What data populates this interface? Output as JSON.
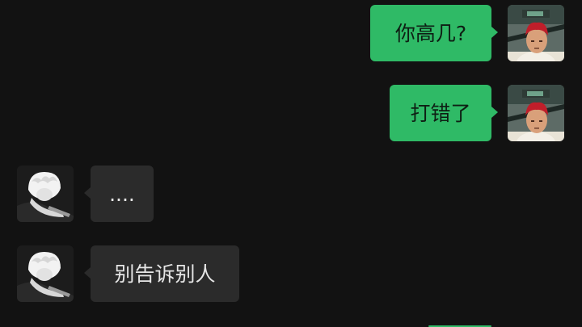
{
  "conversation": {
    "messages": [
      {
        "side": "right",
        "avatar": "sender-avatar-icon",
        "text": "你高几?"
      },
      {
        "side": "right",
        "avatar": "sender-avatar-icon",
        "text": "打错了"
      },
      {
        "side": "left",
        "avatar": "contact-avatar-icon",
        "text": "...."
      },
      {
        "side": "left",
        "avatar": "contact-avatar-icon",
        "text": "别告诉别人"
      },
      {
        "side": "right",
        "avatar": "sender-avatar-icon",
        "text": ""
      }
    ]
  },
  "colors": {
    "background": "#121212",
    "outgoing_bubble": "#2fba66",
    "incoming_bubble": "#2b2b2b",
    "incoming_text": "#e6e6e6"
  }
}
